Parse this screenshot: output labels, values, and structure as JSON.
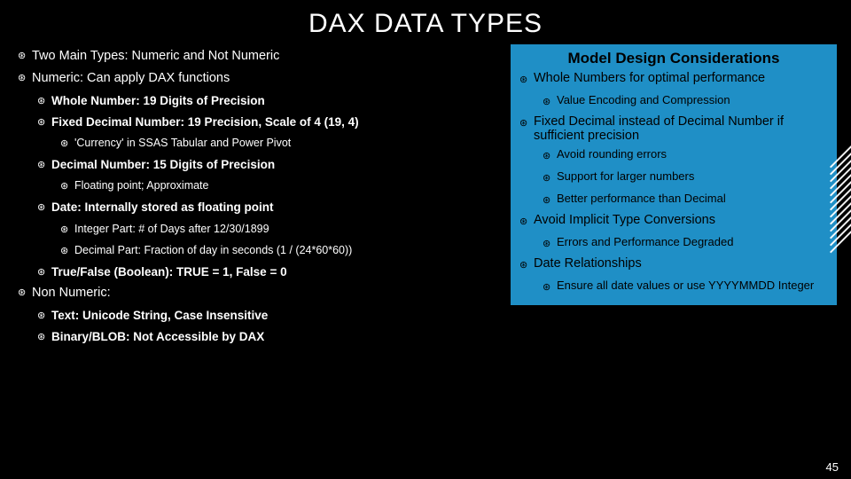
{
  "title": "DAX DATA TYPES",
  "page_number": "45",
  "left": {
    "l1a": "Two Main Types: Numeric and Not Numeric",
    "l1b": "Numeric: Can apply DAX functions",
    "l2a": "Whole Number: 19 Digits of Precision",
    "l2b": "Fixed Decimal Number: 19 Precision, Scale of 4 (19, 4)",
    "l3a": "'Currency' in SSAS Tabular and Power Pivot",
    "l2c": "Decimal Number: 15 Digits of Precision",
    "l3b": "Floating point; Approximate",
    "l2d": "Date: Internally stored as floating point",
    "l3c": "Integer Part: # of Days after 12/30/1899",
    "l3d": "Decimal Part: Fraction of day in seconds (1 / (24*60*60))",
    "l2e": "True/False (Boolean): TRUE = 1, False = 0",
    "l1c": "Non Numeric:",
    "l2f": "Text: Unicode String, Case Insensitive",
    "l2g": "Binary/BLOB: Not Accessible by DAX"
  },
  "right": {
    "title": "Model Design Considerations",
    "r1a": "Whole Numbers for optimal performance",
    "r2a": "Value Encoding and Compression",
    "r1b": "Fixed Decimal instead of Decimal Number if sufficient precision",
    "r2b": "Avoid rounding errors",
    "r2c": "Support for larger numbers",
    "r2d": "Better performance than Decimal",
    "r1c": "Avoid Implicit Type Conversions",
    "r2e": "Errors and Performance Degraded",
    "r1d": "Date Relationships",
    "r2f": "Ensure all date values or use YYYYMMDD Integer"
  }
}
